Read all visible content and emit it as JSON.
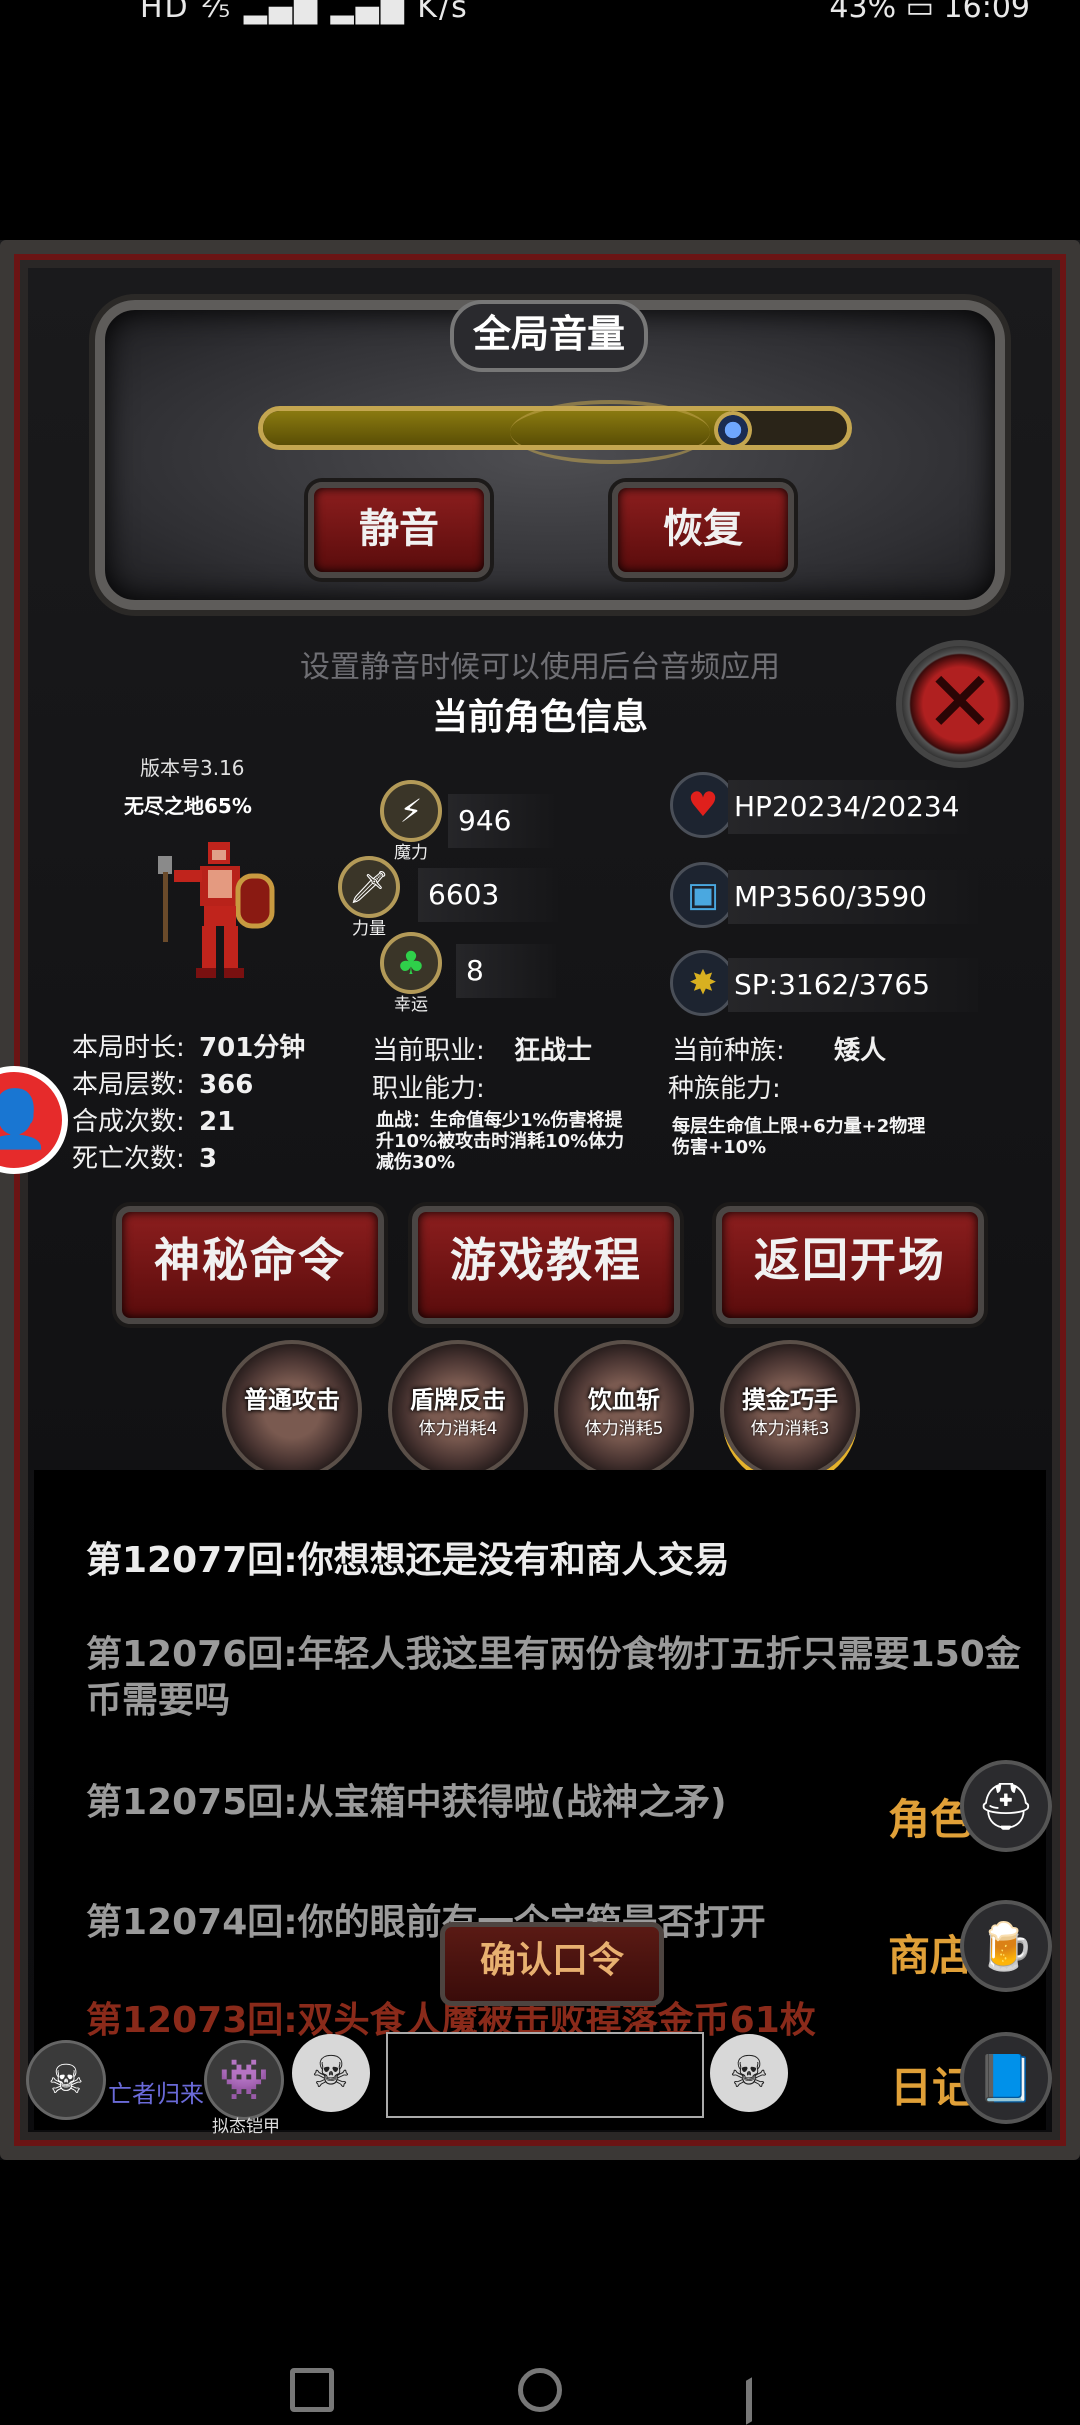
{
  "status_bar": {
    "left": "HD ⅖ ▂▄▆ ▂▄▆ K/s",
    "speed_unit": "K/s",
    "battery": "43%",
    "time": "16:09"
  },
  "volume": {
    "title": "全局音量",
    "level": 0.8,
    "mute_label": "静音",
    "restore_label": "恢复",
    "hint": "设置静音时候可以使用后台音频应用"
  },
  "character": {
    "title": "当前角色信息",
    "version": "版本号3.16",
    "zone": "无尽之地65%",
    "stats": [
      {
        "label": "魔力",
        "value": "946"
      },
      {
        "label": "力量",
        "value": "6603"
      },
      {
        "label": "幸运",
        "value": "8"
      }
    ],
    "resources": {
      "hp": "HP20234/20234",
      "mp": "MP3560/3590",
      "sp": "SP:3162/3765"
    },
    "run_info": [
      {
        "label": "本局时长:",
        "value": "701分钟"
      },
      {
        "label": "本局层数:",
        "value": "366"
      },
      {
        "label": "合成次数:",
        "value": "21"
      },
      {
        "label": "死亡次数:",
        "value": "3"
      }
    ],
    "job_label": "当前职业:",
    "job_value": "狂战士",
    "job_ability_label": "职业能力:",
    "job_ability_desc": "血战：生命值每少1%伤害将提升10%被攻击时消耗10%体力减伤30%",
    "race_label": "当前种族:",
    "race_value": "矮人",
    "race_ability_label": "种族能力:",
    "race_ability_desc": "每层生命值上限+6力量+2物理伤害+10%"
  },
  "buttons": {
    "secret": "神秘命令",
    "tutorial": "游戏教程",
    "back": "返回开场"
  },
  "skills": [
    {
      "name": "普通攻击",
      "cost": ""
    },
    {
      "name": "盾牌反击",
      "cost": "体力消耗4"
    },
    {
      "name": "饮血斩",
      "cost": "体力消耗5"
    },
    {
      "name": "摸金巧手",
      "cost": "体力消耗3"
    }
  ],
  "log": [
    "第12077回:你想想还是没有和商人交易",
    "第12076回:年轻人我这里有两份食物打五折只需要150金币需要吗",
    "第12075回:从宝箱中获得啦(战神之矛)",
    "第12074回:你的眼前有一个宝箱是否打开",
    "第12073回:双头食人魔被击败掉落金币61枚"
  ],
  "side_menu": {
    "role": "角色",
    "shop": "商店",
    "diary": "日记"
  },
  "confirm_label": "确认口令",
  "bottom": {
    "player1": "亡者归来",
    "player2": "拟态铠甲"
  }
}
